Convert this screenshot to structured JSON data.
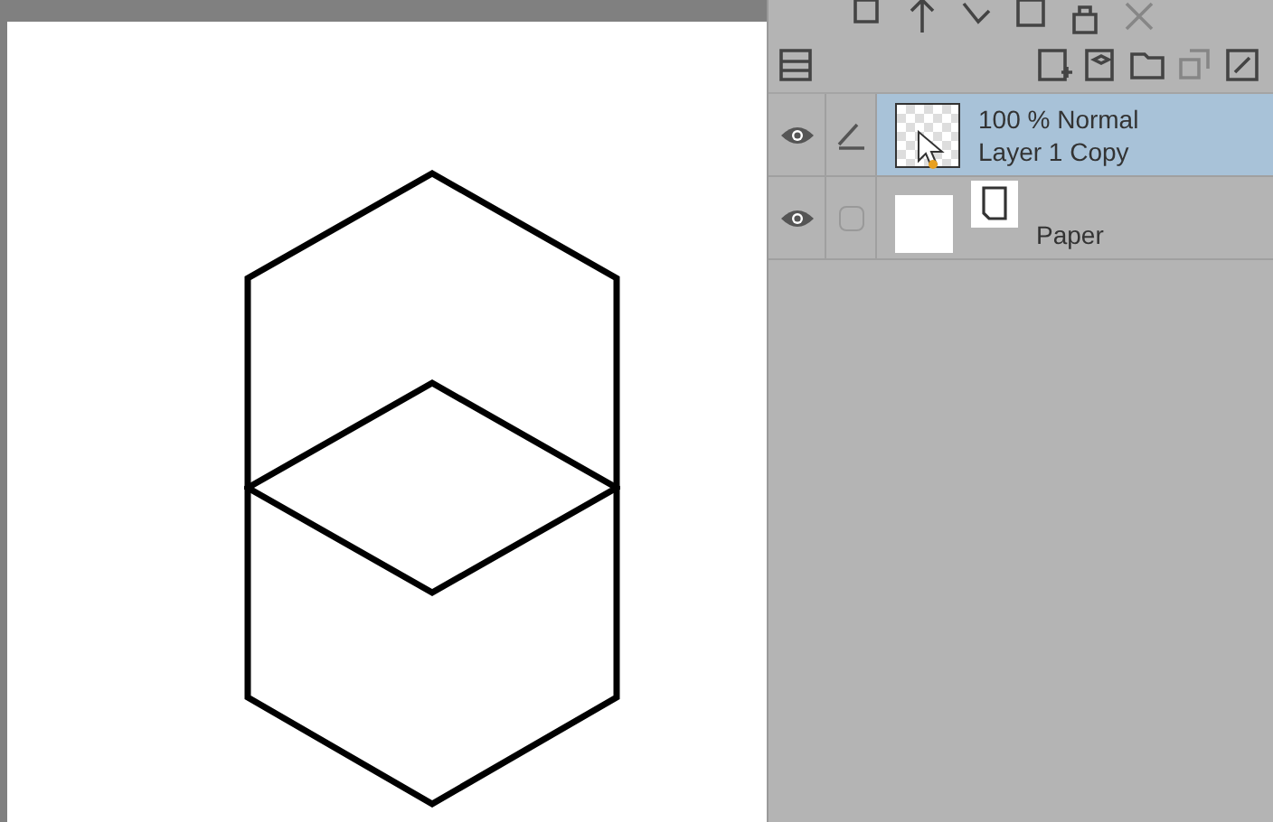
{
  "layers": [
    {
      "kind": "raster",
      "blend": "100 % Normal",
      "name": "Layer 1 Copy",
      "visible": true,
      "editing": true,
      "selected": true
    },
    {
      "kind": "paper",
      "name": "Paper",
      "visible": true,
      "editing": false,
      "selected": false
    }
  ]
}
